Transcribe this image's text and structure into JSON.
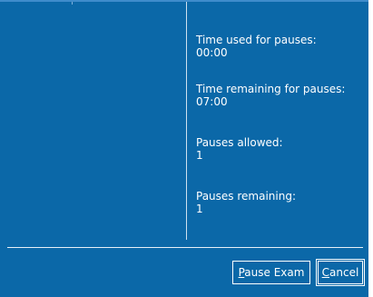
{
  "info": {
    "time_used_label": "Time used for pauses:",
    "time_used_value": "00:00",
    "time_remaining_label": "Time remaining for pauses:",
    "time_remaining_value": "07:00",
    "pauses_allowed_label": "Pauses allowed:",
    "pauses_allowed_value": "1",
    "pauses_remaining_label": "Pauses remaining:",
    "pauses_remaining_value": "1"
  },
  "buttons": {
    "pause_exam_mnemonic": "P",
    "pause_exam_rest": "ause Exam",
    "cancel_mnemonic": "C",
    "cancel_rest": "ancel"
  },
  "colors": {
    "background": "#0b68a8",
    "text": "#ffffff"
  }
}
